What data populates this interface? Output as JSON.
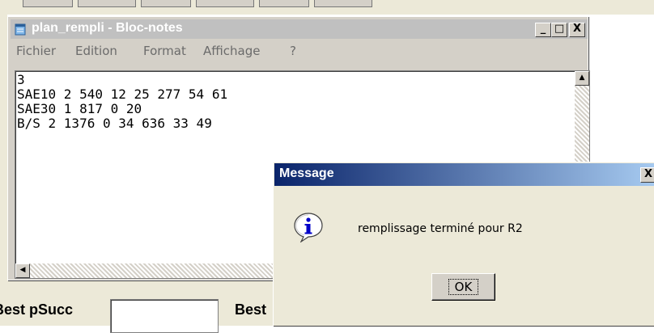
{
  "notepad": {
    "title": "plan_rempli - Bloc-notes",
    "menu": [
      "Fichier",
      "Edition",
      "Format",
      "Affichage",
      "?"
    ],
    "content": "3\nSAE10 2 540 12 25 277 54 61\nSAE30 1 817 0 20\nB/S 2 1376 0 34 636 33 49",
    "buttons": {
      "minimize": "_",
      "maximize": "□",
      "close": "X"
    }
  },
  "dialog": {
    "title": "Message",
    "message": "remplissage terminé pour R2",
    "ok_label": "OK",
    "close_label": "X",
    "icon": "info-icon"
  },
  "background_app": {
    "label_1": "Best pSucc",
    "label_2": "Best"
  },
  "colors": {
    "dialog_title_start": "#0a246a",
    "dialog_title_end": "#a6caf0",
    "notepad_title_inactive": "#c0c0c0"
  }
}
